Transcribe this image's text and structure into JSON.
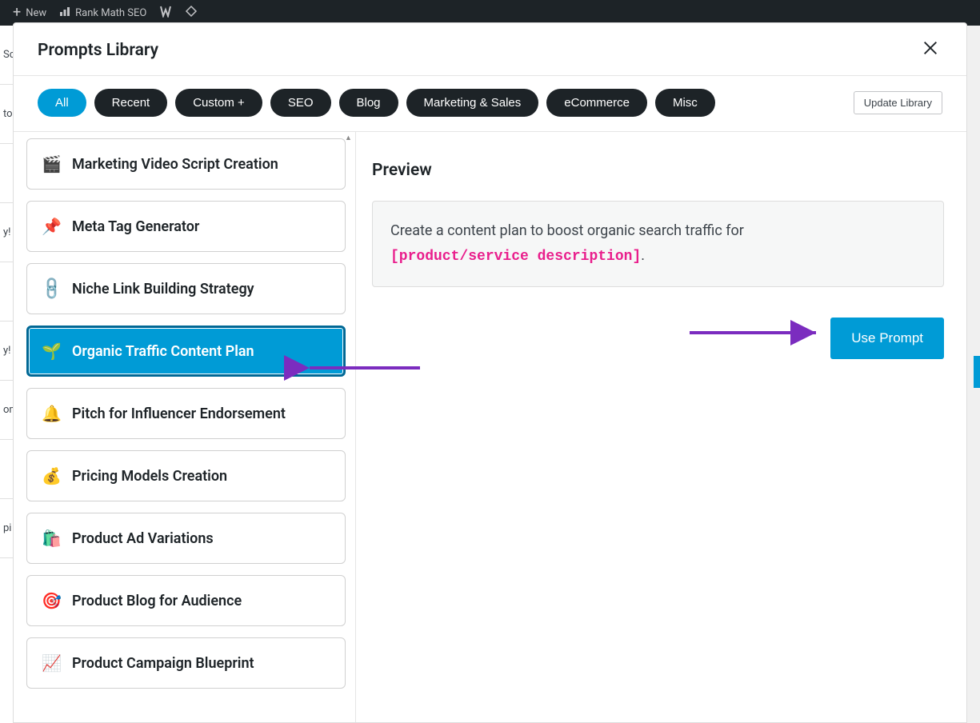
{
  "admin_bar": {
    "new_label": "New",
    "rank_math_label": "Rank Math SEO"
  },
  "modal": {
    "title": "Prompts Library",
    "update_button": "Update Library"
  },
  "filters": {
    "items": [
      {
        "label": "All",
        "active": true
      },
      {
        "label": "Recent",
        "active": false
      },
      {
        "label": "Custom +",
        "active": false
      },
      {
        "label": "SEO",
        "active": false
      },
      {
        "label": "Blog",
        "active": false
      },
      {
        "label": "Marketing & Sales",
        "active": false
      },
      {
        "label": "eCommerce",
        "active": false
      },
      {
        "label": "Misc",
        "active": false
      }
    ]
  },
  "prompts": [
    {
      "icon": "🎬",
      "label": "Marketing Video Script Creation",
      "selected": false
    },
    {
      "icon": "📌",
      "label": "Meta Tag Generator",
      "selected": false
    },
    {
      "icon": "🔗",
      "label": "Niche Link Building Strategy",
      "selected": false,
      "chain": true
    },
    {
      "icon": "🌱",
      "label": "Organic Traffic Content Plan",
      "selected": true
    },
    {
      "icon": "🔔",
      "label": "Pitch for Influencer Endorsement",
      "selected": false
    },
    {
      "icon": "💰",
      "label": "Pricing Models Creation",
      "selected": false
    },
    {
      "icon": "🛍️",
      "label": "Product Ad Variations",
      "selected": false
    },
    {
      "icon": "🎯",
      "label": "Product Blog for Audience",
      "selected": false
    },
    {
      "icon": "📈",
      "label": "Product Campaign Blueprint",
      "selected": false
    }
  ],
  "preview": {
    "title": "Preview",
    "text_before": "Create a content plan to boost organic search traffic for ",
    "placeholder": "[product/service description]",
    "text_after": ".",
    "use_button": "Use Prompt"
  },
  "bg_rows": [
    "Sc",
    "to",
    "",
    "y!",
    "",
    "y!",
    "om",
    "",
    "pi",
    ""
  ],
  "colors": {
    "primary": "#009bd6",
    "dark": "#1d2327",
    "placeholder": "#e91e8c",
    "arrow": "#7b2cbf"
  }
}
